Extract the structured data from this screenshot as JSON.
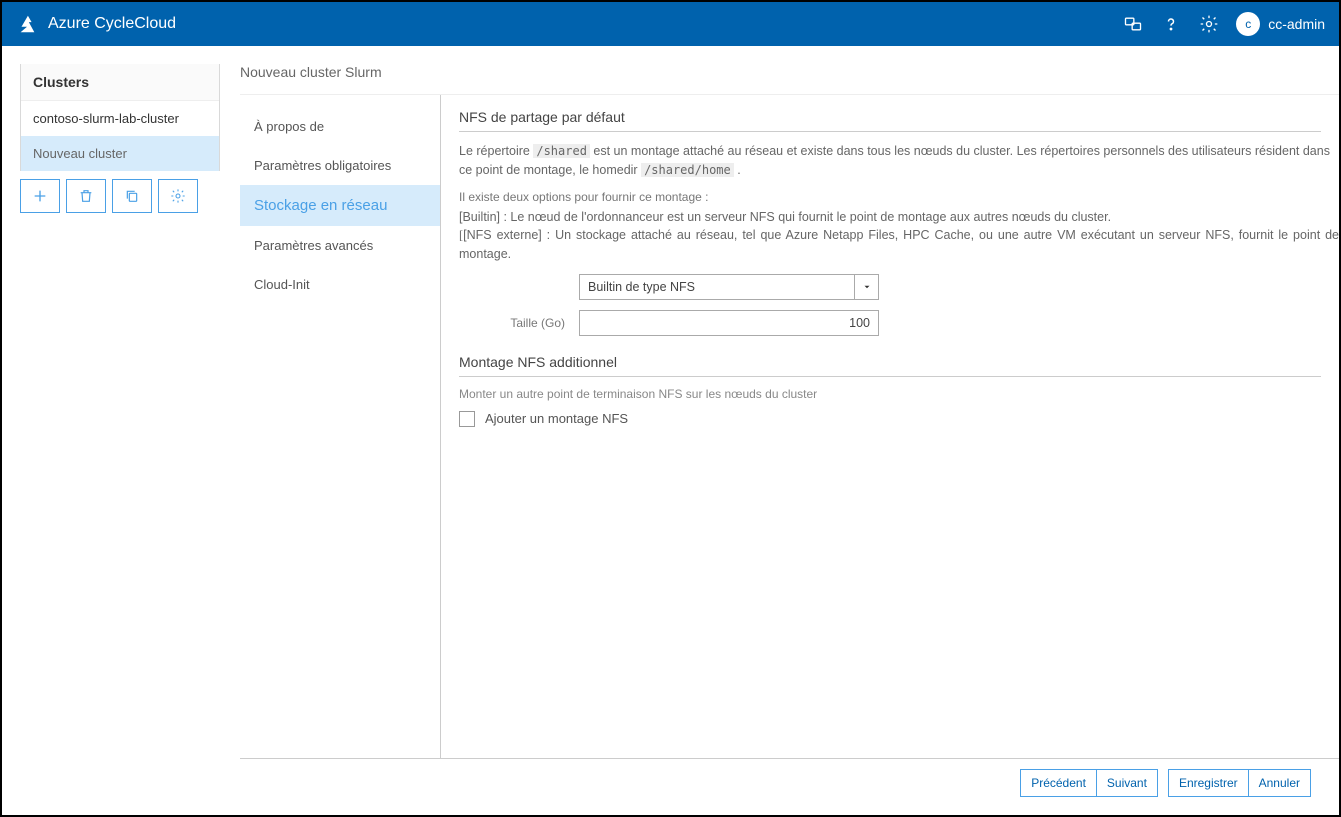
{
  "header": {
    "app_title": "Azure CycleCloud",
    "avatar_letter": "c",
    "username": "cc-admin"
  },
  "sidebar": {
    "title": "Clusters",
    "items": [
      {
        "label": "contoso-slurm-lab-cluster",
        "selected": false
      },
      {
        "label": "Nouveau cluster",
        "selected": true
      }
    ]
  },
  "page": {
    "title": "Nouveau cluster Slurm",
    "steps": [
      {
        "label": "À propos de"
      },
      {
        "label": "Paramètres obligatoires"
      },
      {
        "label": "Stockage en réseau",
        "active": true
      },
      {
        "label": "Paramètres avancés"
      },
      {
        "label": "Cloud-Init"
      }
    ]
  },
  "section1": {
    "title": "NFS de partage par défaut",
    "p1_a": "Le répertoire ",
    "p1_code1": "/shared",
    "p1_b": " est un montage attaché au réseau et existe dans tous les nœuds du cluster. Les répertoires personnels des utilisateurs résident dans ce point de montage, le homedir ",
    "p1_code2": "/shared/home",
    "p1_c": " .",
    "opts_intro": "Il existe deux options pour fournir ce montage :",
    "opt1": "[Builtin] : Le nœud de l'ordonnanceur est un serveur NFS qui fournit le point de montage aux autres nœuds du cluster.",
    "opt2_bracket": "[",
    "opt2_rest": "[NFS externe] : Un stockage attaché au réseau, tel que Azure Netapp Files, HPC Cache, ou une autre VM exécutant un serveur NFS, fournit le point de montage.",
    "nfs_type_value": "Builtin de type NFS",
    "size_label": "Taille (Go)",
    "size_value": "100"
  },
  "section2": {
    "title": "Montage NFS additionnel",
    "desc": "Monter un autre point de terminaison NFS sur les nœuds du cluster",
    "checkbox_label": "Ajouter un montage NFS"
  },
  "footer": {
    "prev": "Précédent",
    "next": "Suivant",
    "save": "Enregistrer",
    "cancel": "Annuler"
  }
}
